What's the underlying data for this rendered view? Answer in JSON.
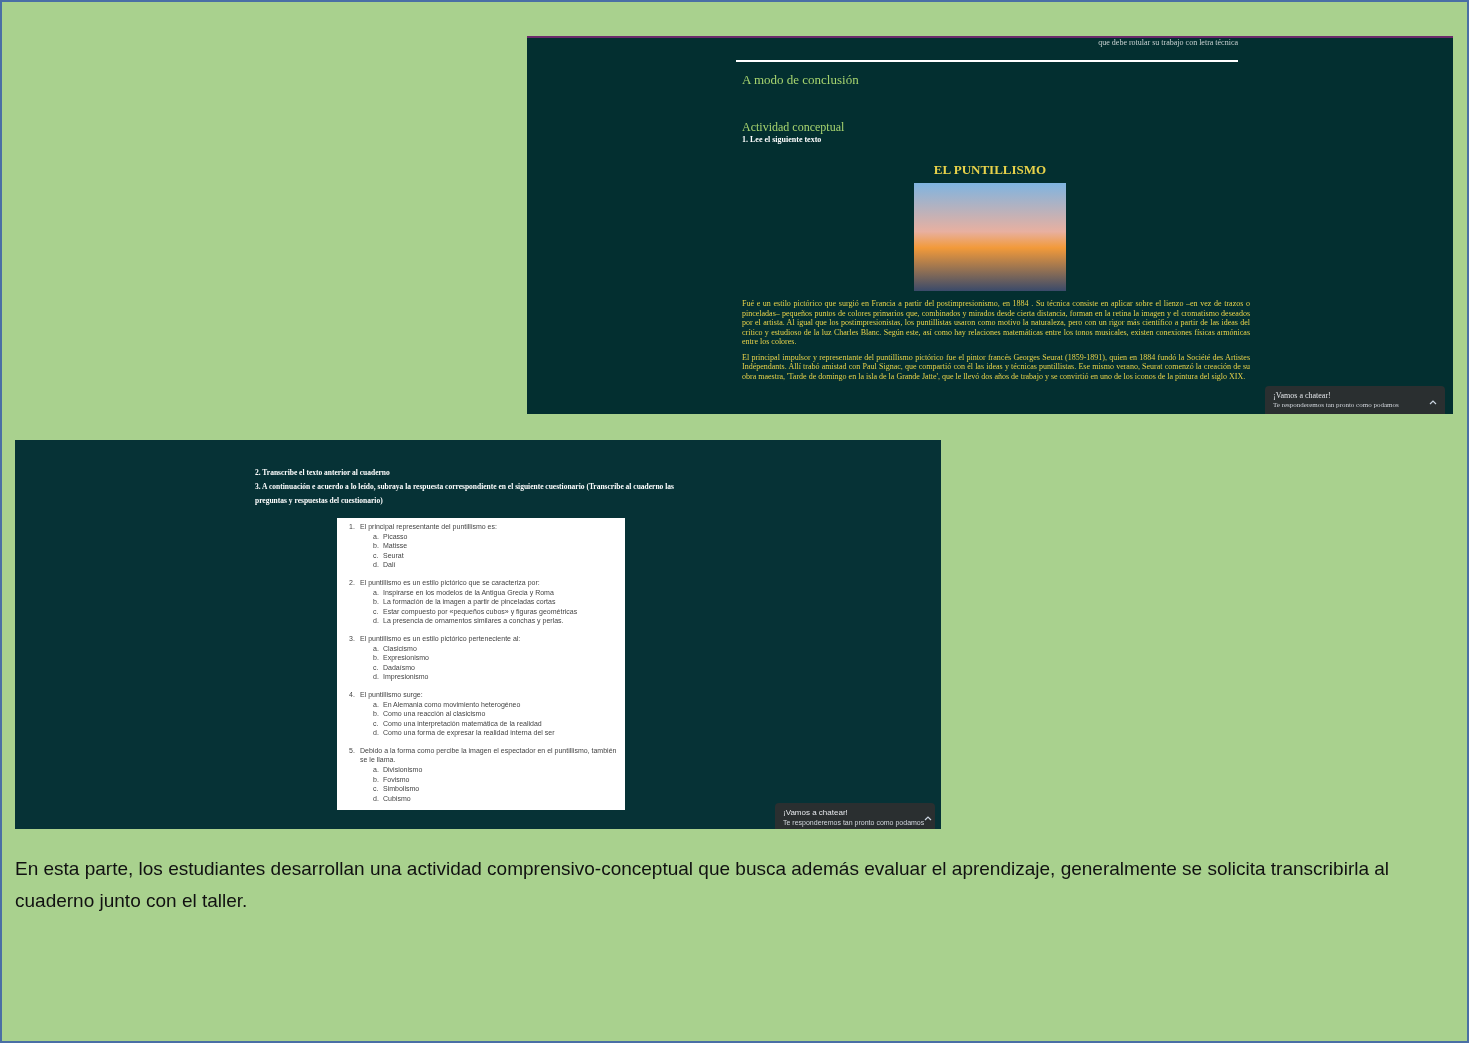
{
  "top_screenshot": {
    "cut_line": "que debe rotular su trabajo con letra técnica",
    "heading": "A modo de conclusión",
    "subheading": "Actividad conceptual",
    "instruction": "1. Lee el siguiente texto",
    "article_title": "EL PUNTILLISMO",
    "paragraphs": [
      "Fué e un estilo pictórico que surgió en Francia a partir del postimpresionismo, en 1884 . Su técnica consiste en aplicar sobre el lienzo –en vez de trazos o pinceladas– pequeños puntos de colores primarios que, combinados y mirados desde cierta distancia, forman en la retina la imagen y el cromatismo deseados por el artista. Al igual que los postimpresionistas, los puntillistas usaron como motivo la naturaleza, pero con un rigor más científico a partir de las ideas del crítico y estudioso de la luz Charles Blanc. Según este, así como hay relaciones matemáticas entre los tonos musicales, existen conexiones físicas armónicas entre los colores.",
      "El principal impulsor y representante del puntillismo pictórico fue el pintor francés Georges Seurat (1859-1891), quien en 1884 fundó la Société des Artistes Indépendants. Allí trabó amistad con Paul Signac, que compartió con él las ideas y técnicas puntillistas. Ese mismo verano, Seurat comenzó la creación de su obra maestra, 'Tarde de domingo en la isla de la Grande Jatte', que le llevó dos años de trabajo y se convirtió en uno de los iconos de la pintura del siglo XIX."
    ],
    "chat": {
      "title": "¡Vamos a chatear!",
      "subtitle": "Te responderemos tan pronto como podamos"
    }
  },
  "bottom_screenshot": {
    "instructions": [
      "2. Transcribe el texto anterior al cuaderno",
      "3. A continuación e acuerdo a lo leído, subraya la respuesta correspondiente en el siguiente cuestionario  (Transcribe al cuaderno las  preguntas y respuestas del cuestionario)"
    ],
    "questions": [
      {
        "number": "1.",
        "text": "El principal representante del puntillismo es:",
        "options": [
          {
            "letter": "a.",
            "text": "Picasso"
          },
          {
            "letter": "b.",
            "text": "Matisse"
          },
          {
            "letter": "c.",
            "text": "Seurat"
          },
          {
            "letter": "d.",
            "text": "Dalí"
          }
        ]
      },
      {
        "number": "2.",
        "text": "El puntillismo es un estilo pictórico que se caracteriza por:",
        "options": [
          {
            "letter": "a.",
            "text": "Inspirarse en los modelos de la Antigua Grecia y Roma"
          },
          {
            "letter": "b.",
            "text": "La formación de la imagen  a partir de pinceladas cortas"
          },
          {
            "letter": "c.",
            "text": "Estar compuesto por «pequeños cubos» y figuras geométricas"
          },
          {
            "letter": "d.",
            "text": "La presencia de ornamentos similares a conchas y perlas."
          }
        ]
      },
      {
        "number": "3.",
        "text": "El puntillismo es un estilo pictórico perteneciente al:",
        "options": [
          {
            "letter": "a.",
            "text": "Clasicismo"
          },
          {
            "letter": "b.",
            "text": "Expresionismo"
          },
          {
            "letter": "c.",
            "text": "Dadaísmo"
          },
          {
            "letter": "d.",
            "text": "Impresionismo"
          }
        ]
      },
      {
        "number": "4.",
        "text": "El puntillismo surge:",
        "options": [
          {
            "letter": "a.",
            "text": "En Alemania como movimiento heterogéneo"
          },
          {
            "letter": "b.",
            "text": "Como una reacción al clasicismo"
          },
          {
            "letter": "c.",
            "text": "Como una interpretación matemática de la realidad"
          },
          {
            "letter": "d.",
            "text": "Como una forma de expresar la realidad  interna del ser"
          }
        ]
      },
      {
        "number": "5.",
        "text": "Debido a la forma como percibe la imagen el espectador en el puntillismo, también se le llama.",
        "options": [
          {
            "letter": "a.",
            "text": "Divisionismo"
          },
          {
            "letter": "b.",
            "text": "Fovismo"
          },
          {
            "letter": "c.",
            "text": "Simbolismo"
          },
          {
            "letter": "d.",
            "text": "Cubismo"
          }
        ]
      }
    ],
    "chat": {
      "title": "¡Vamos a chatear!",
      "subtitle": "Te responderemos tan pronto como podamos"
    }
  },
  "caption": "En esta parte, los estudiantes desarrollan una actividad comprensivo-conceptual que busca además evaluar el aprendizaje, generalmente se solicita transcribirla  al cuaderno junto con el taller."
}
